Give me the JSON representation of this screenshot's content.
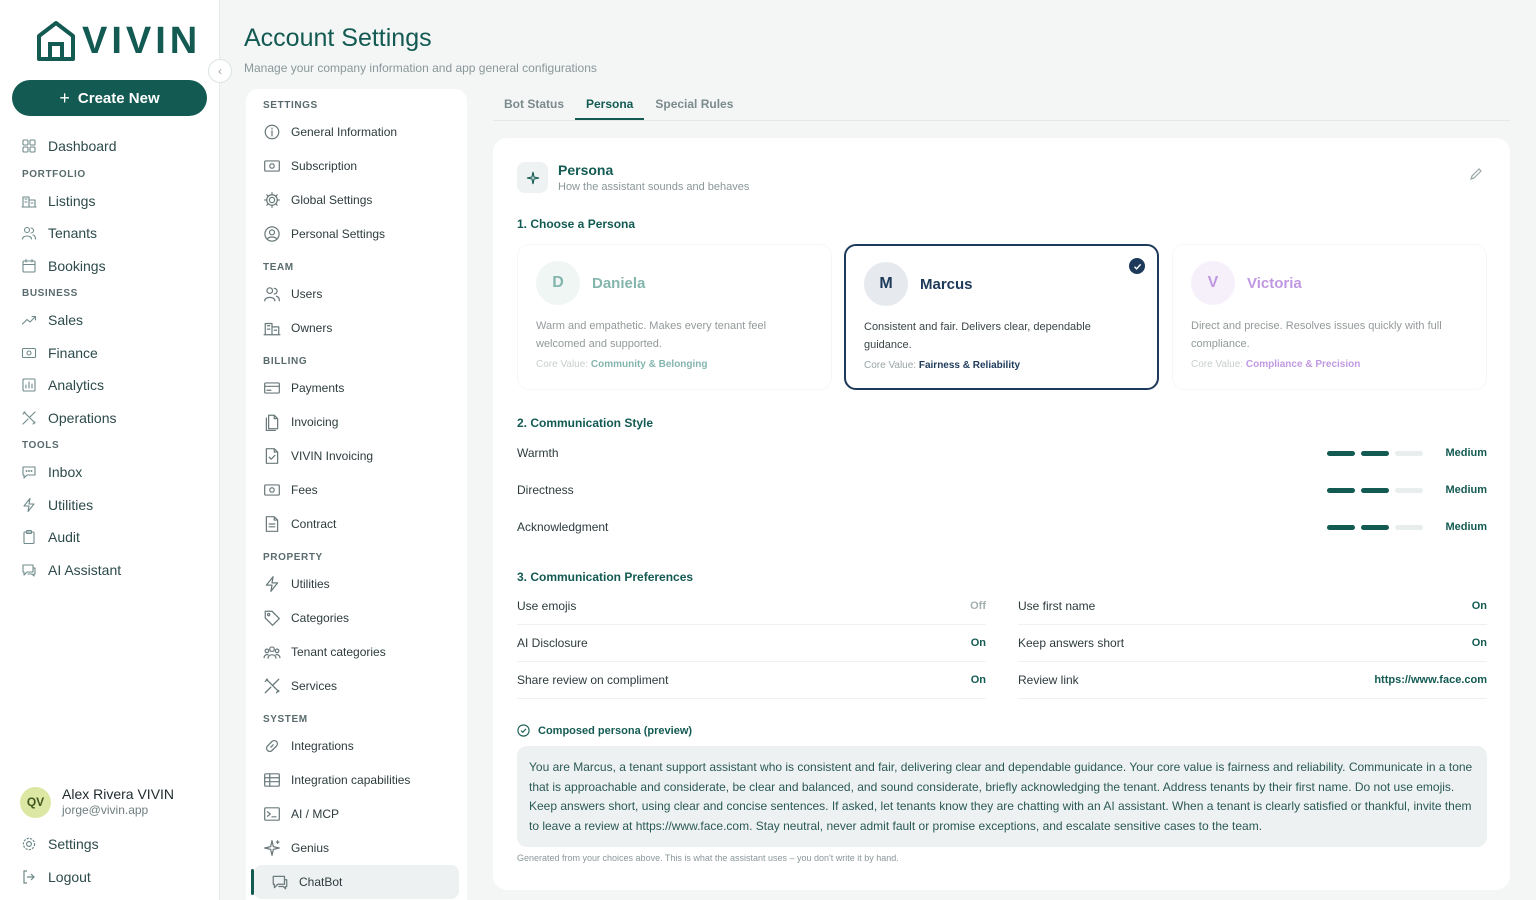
{
  "brand": {
    "name": "VIVIN",
    "accent": "#135a52"
  },
  "nav": {
    "create_label": "Create New",
    "items": [
      {
        "type": "item",
        "label": "Dashboard",
        "icon": "grid-icon"
      },
      {
        "type": "section",
        "label": "PORTFOLIO"
      },
      {
        "type": "item",
        "label": "Listings",
        "icon": "building-icon"
      },
      {
        "type": "item",
        "label": "Tenants",
        "icon": "users-icon"
      },
      {
        "type": "item",
        "label": "Bookings",
        "icon": "calendar-icon"
      },
      {
        "type": "section",
        "label": "BUSINESS"
      },
      {
        "type": "item",
        "label": "Sales",
        "icon": "trend-icon"
      },
      {
        "type": "item",
        "label": "Finance",
        "icon": "money-icon"
      },
      {
        "type": "item",
        "label": "Analytics",
        "icon": "chart-icon"
      },
      {
        "type": "item",
        "label": "Operations",
        "icon": "tools-icon"
      },
      {
        "type": "section",
        "label": "TOOLS"
      },
      {
        "type": "item",
        "label": "Inbox",
        "icon": "chat-icon"
      },
      {
        "type": "item",
        "label": "Utilities",
        "icon": "bolt-icon"
      },
      {
        "type": "item",
        "label": "Audit",
        "icon": "clipboard-icon"
      },
      {
        "type": "item",
        "label": "AI Assistant",
        "icon": "bot-chat-icon"
      }
    ],
    "user": {
      "initials": "QV",
      "name": "Alex Rivera VIVIN",
      "email": "jorge@vivin.app"
    },
    "settings_label": "Settings",
    "logout_label": "Logout"
  },
  "header": {
    "title": "Account Settings",
    "subtitle": "Manage your company information and app general configurations"
  },
  "settings_menu": [
    {
      "type": "section",
      "label": "SETTINGS"
    },
    {
      "type": "item",
      "label": "General Information",
      "icon": "info-icon"
    },
    {
      "type": "item",
      "label": "Subscription",
      "icon": "money-icon"
    },
    {
      "type": "item",
      "label": "Global Settings",
      "icon": "gear-icon"
    },
    {
      "type": "item",
      "label": "Personal Settings",
      "icon": "user-circle-icon"
    },
    {
      "type": "section",
      "label": "TEAM"
    },
    {
      "type": "item",
      "label": "Users",
      "icon": "users-icon"
    },
    {
      "type": "item",
      "label": "Owners",
      "icon": "building-icon"
    },
    {
      "type": "section",
      "label": "BILLING"
    },
    {
      "type": "item",
      "label": "Payments",
      "icon": "card-icon"
    },
    {
      "type": "item",
      "label": "Invoicing",
      "icon": "files-icon"
    },
    {
      "type": "item",
      "label": "VIVIN Invoicing",
      "icon": "file-check-icon"
    },
    {
      "type": "item",
      "label": "Fees",
      "icon": "money-icon"
    },
    {
      "type": "item",
      "label": "Contract",
      "icon": "file-icon"
    },
    {
      "type": "section",
      "label": "PROPERTY"
    },
    {
      "type": "item",
      "label": "Utilities",
      "icon": "bolt-icon"
    },
    {
      "type": "item",
      "label": "Categories",
      "icon": "tag-icon"
    },
    {
      "type": "item",
      "label": "Tenant categories",
      "icon": "users-group-icon"
    },
    {
      "type": "item",
      "label": "Services",
      "icon": "tools-icon"
    },
    {
      "type": "section",
      "label": "SYSTEM"
    },
    {
      "type": "item",
      "label": "Integrations",
      "icon": "link-icon"
    },
    {
      "type": "item",
      "label": "Integration capabilities",
      "icon": "table-icon"
    },
    {
      "type": "item",
      "label": "AI / MCP",
      "icon": "terminal-icon"
    },
    {
      "type": "item",
      "label": "Genius",
      "icon": "sparkle-icon"
    },
    {
      "type": "item",
      "label": "ChatBot",
      "icon": "bot-chat-icon",
      "active": true
    }
  ],
  "tabs": [
    {
      "label": "Bot Status",
      "active": false
    },
    {
      "label": "Persona",
      "active": true
    },
    {
      "label": "Special Rules",
      "active": false
    }
  ],
  "persona_card": {
    "title": "Persona",
    "subtitle": "How the assistant sounds and behaves",
    "section1": "1. Choose a Persona",
    "personas": [
      {
        "initial": "D",
        "name": "Daniela",
        "desc": "Warm and empathetic. Makes every tenant feel welcomed and supported.",
        "core_label": "Core Value:",
        "core_value": "Community & Belonging",
        "color": "#1f7a6a",
        "bg": "#e2efec",
        "selected": false
      },
      {
        "initial": "M",
        "name": "Marcus",
        "desc": "Consistent and fair. Delivers clear, dependable guidance.",
        "core_label": "Core Value:",
        "core_value": "Fairness & Reliability",
        "color": "#1e3a5a",
        "bg": "#e6eaee",
        "selected": true
      },
      {
        "initial": "V",
        "name": "Victoria",
        "desc": "Direct and precise. Resolves issues quickly with full compliance.",
        "core_label": "Core Value:",
        "core_value": "Compliance & Precision",
        "color": "#8e44c9",
        "bg": "#efe5f7",
        "selected": false
      }
    ],
    "section2": "2. Communication Style",
    "styles": [
      {
        "label": "Warmth",
        "level": 2,
        "max": 3,
        "value": "Medium"
      },
      {
        "label": "Directness",
        "level": 2,
        "max": 3,
        "value": "Medium"
      },
      {
        "label": "Acknowledgment",
        "level": 2,
        "max": 3,
        "value": "Medium"
      }
    ],
    "section3": "3. Communication Preferences",
    "prefs_left": [
      {
        "label": "Use emojis",
        "value": "Off"
      },
      {
        "label": "AI Disclosure",
        "value": "On"
      },
      {
        "label": "Share review on compliment",
        "value": "On"
      }
    ],
    "prefs_right": [
      {
        "label": "Use first name",
        "value": "On"
      },
      {
        "label": "Keep answers short",
        "value": "On"
      },
      {
        "label": "Review link",
        "value": "https://www.face.com"
      }
    ],
    "composed_title": "Composed persona (preview)",
    "composed_text": "You are Marcus, a tenant support assistant who is consistent and fair, delivering clear and dependable guidance. Your core value is fairness and reliability. Communicate in a tone that is approachable and considerate, be clear and balanced, and sound considerate, briefly acknowledging the tenant. Address tenants by their first name. Do not use emojis. Keep answers short, using clear and concise sentences. If asked, let tenants know they are chatting with an AI assistant. When a tenant is clearly satisfied or thankful, invite them to leave a review at https://www.face.com. Stay neutral, never admit fault or promise exceptions, and escalate sensitive cases to the team.",
    "generated_note": "Generated from your choices above. This is what the assistant uses – you don't write it by hand."
  }
}
